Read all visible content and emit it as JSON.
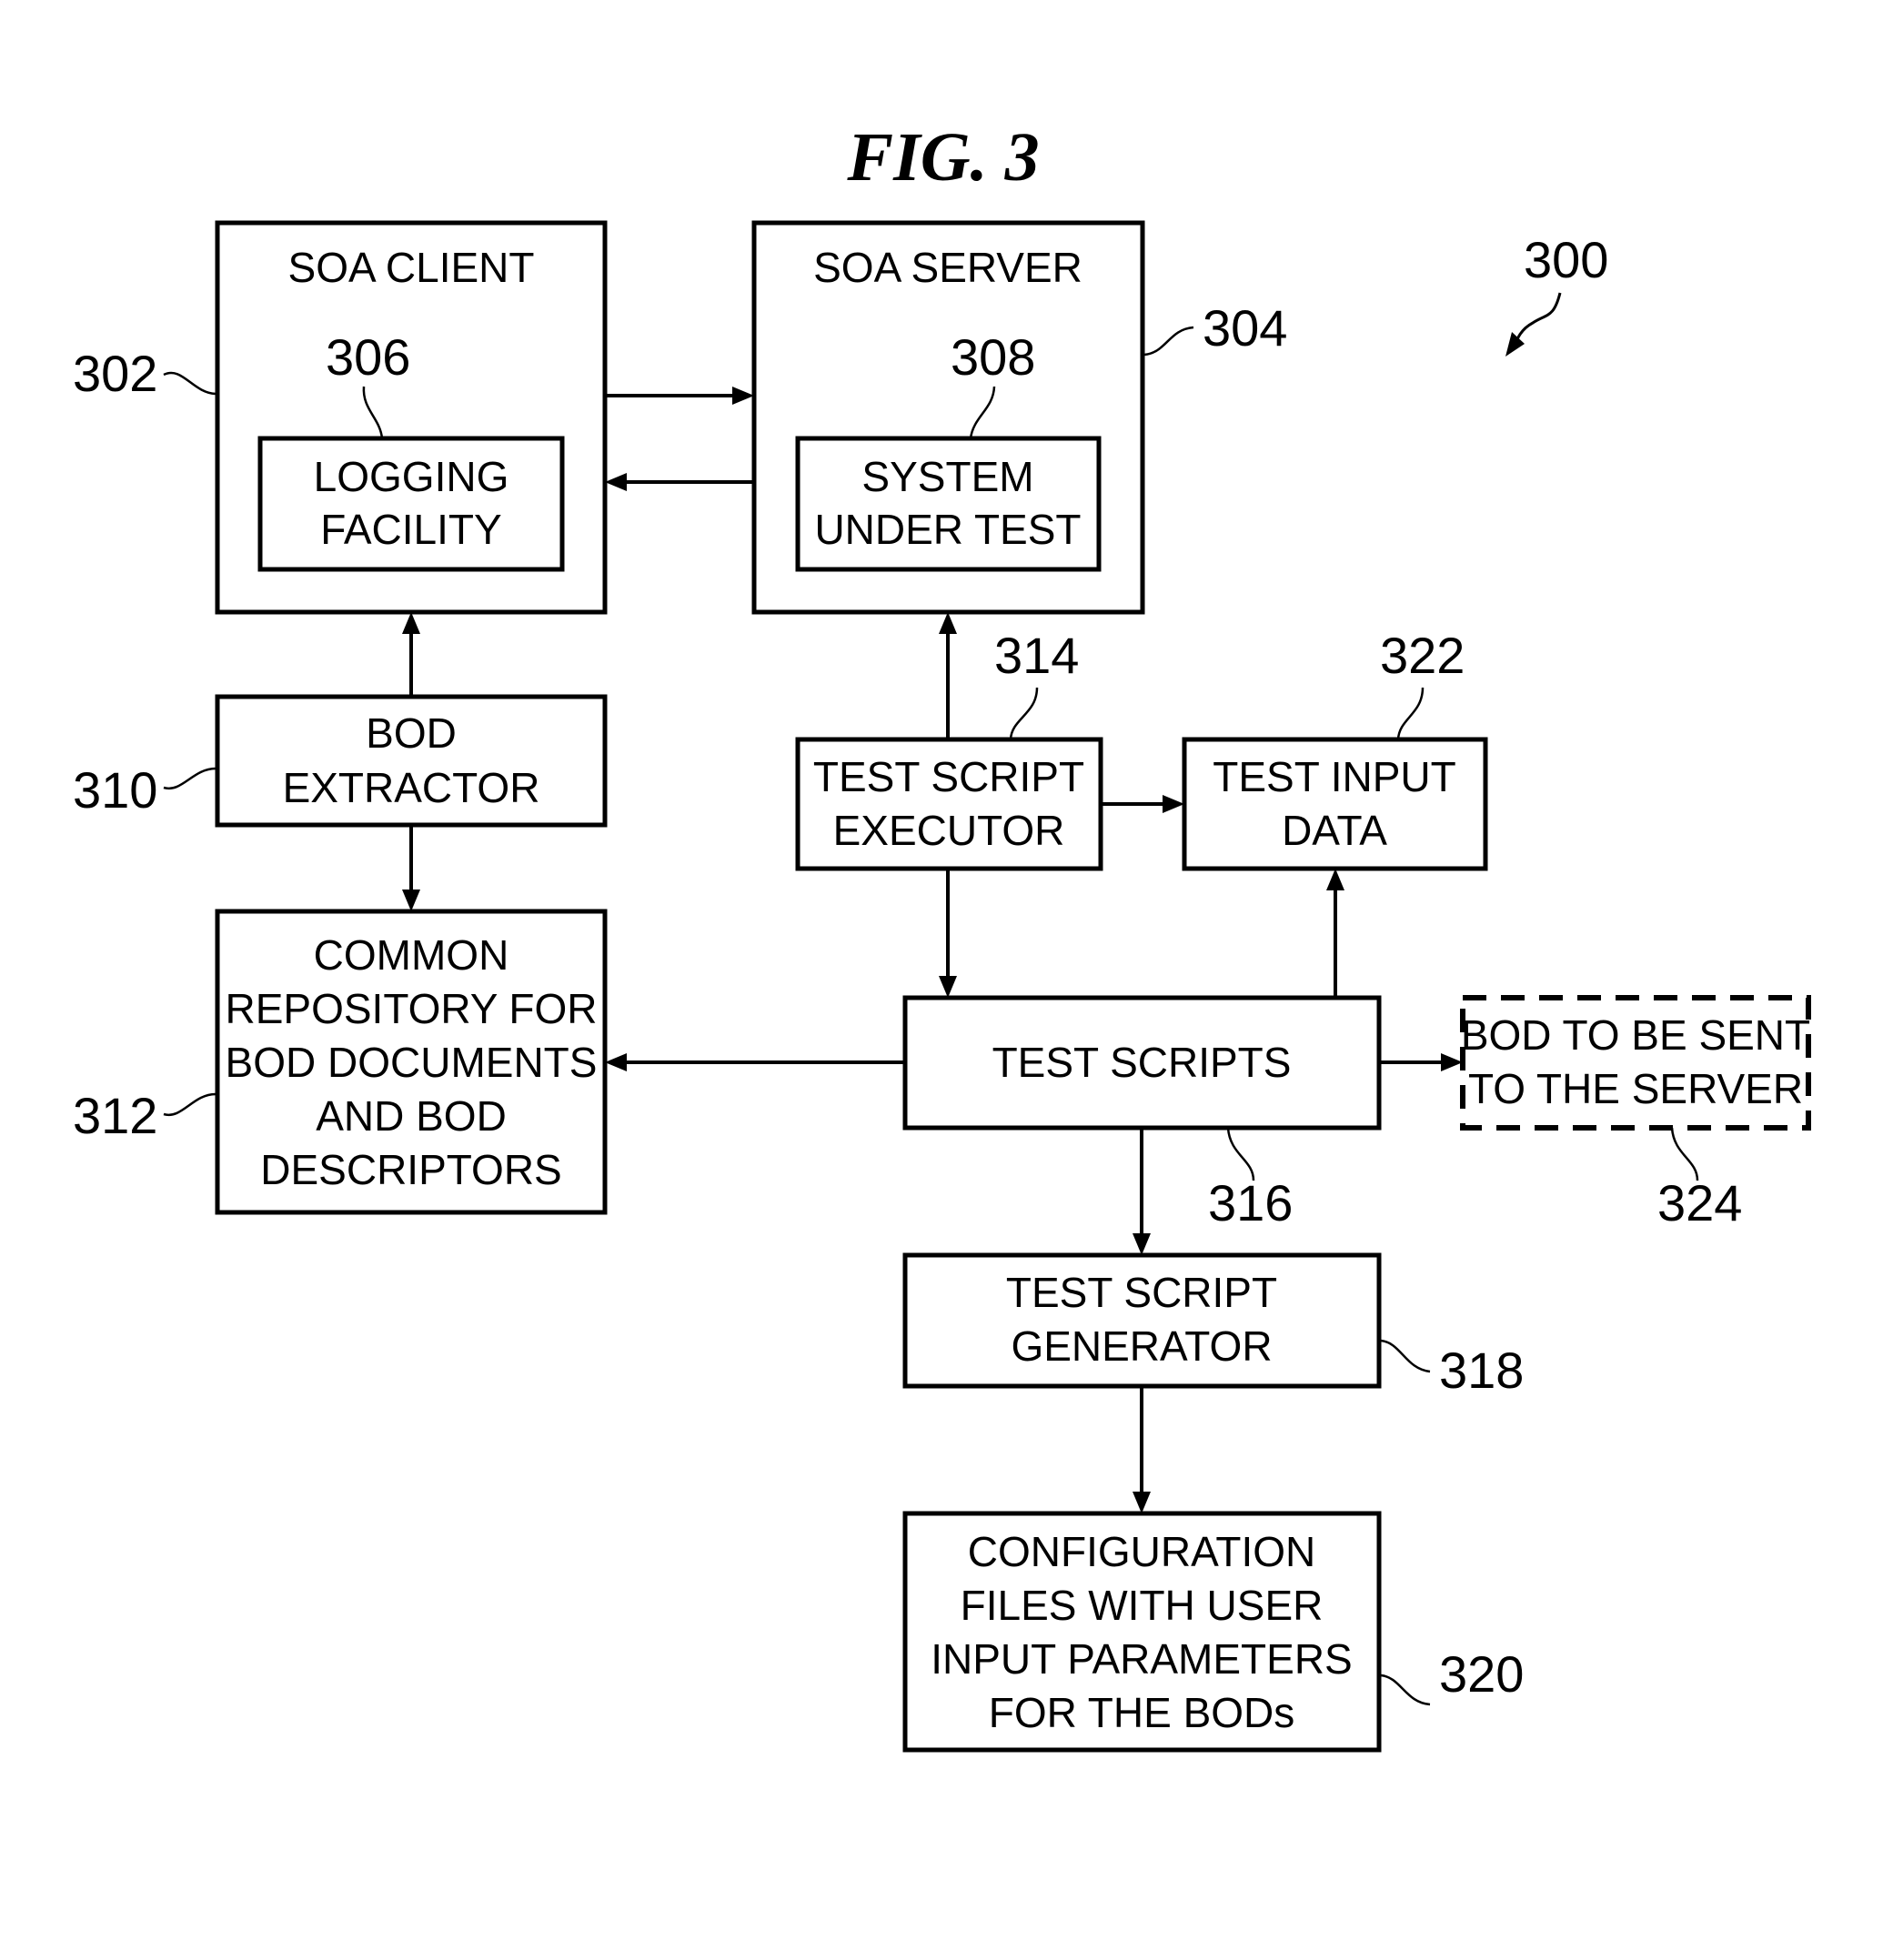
{
  "figure": {
    "title": "FIG. 3",
    "reference": "300"
  },
  "blocks": {
    "soa_client": {
      "ref": "302",
      "lines": [
        "SOA CLIENT"
      ]
    },
    "soa_server": {
      "ref": "304",
      "lines": [
        "SOA SERVER"
      ]
    },
    "logging_facility": {
      "ref": "306",
      "lines": [
        "LOGGING",
        "FACILITY"
      ]
    },
    "system_under_test": {
      "ref": "308",
      "lines": [
        "SYSTEM",
        "UNDER TEST"
      ]
    },
    "bod_extractor": {
      "ref": "310",
      "lines": [
        "BOD",
        "EXTRACTOR"
      ]
    },
    "common_repository": {
      "ref": "312",
      "lines": [
        "COMMON",
        "REPOSITORY FOR",
        "BOD DOCUMENTS",
        "AND BOD",
        "DESCRIPTORS"
      ]
    },
    "test_script_executor": {
      "ref": "314",
      "lines": [
        "TEST SCRIPT",
        "EXECUTOR"
      ]
    },
    "test_scripts": {
      "ref": "316",
      "lines": [
        "TEST SCRIPTS"
      ]
    },
    "test_script_generator": {
      "ref": "318",
      "lines": [
        "TEST SCRIPT",
        "GENERATOR"
      ]
    },
    "configuration_files": {
      "ref": "320",
      "lines": [
        "CONFIGURATION",
        "FILES WITH USER",
        "INPUT PARAMETERS",
        "FOR THE BODs"
      ]
    },
    "test_input_data": {
      "ref": "322",
      "lines": [
        "TEST INPUT",
        "DATA"
      ]
    },
    "bod_to_be_sent": {
      "ref": "324",
      "lines": [
        "BOD TO BE SENT",
        "TO THE SERVER"
      ],
      "style": "dashed"
    }
  },
  "connections": [
    {
      "from": "soa_client",
      "to": "soa_server"
    },
    {
      "from": "soa_server",
      "to": "soa_client"
    },
    {
      "from": "bod_extractor",
      "to": "soa_client"
    },
    {
      "from": "bod_extractor",
      "to": "common_repository"
    },
    {
      "from": "test_script_executor",
      "to": "soa_server"
    },
    {
      "from": "test_script_executor",
      "to": "test_input_data"
    },
    {
      "from": "test_script_executor",
      "to": "test_scripts"
    },
    {
      "from": "test_scripts",
      "to": "test_input_data"
    },
    {
      "from": "test_scripts",
      "to": "common_repository"
    },
    {
      "from": "test_scripts",
      "to": "bod_to_be_sent"
    },
    {
      "from": "test_scripts",
      "to": "test_script_generator"
    },
    {
      "from": "test_script_generator",
      "to": "configuration_files"
    }
  ]
}
